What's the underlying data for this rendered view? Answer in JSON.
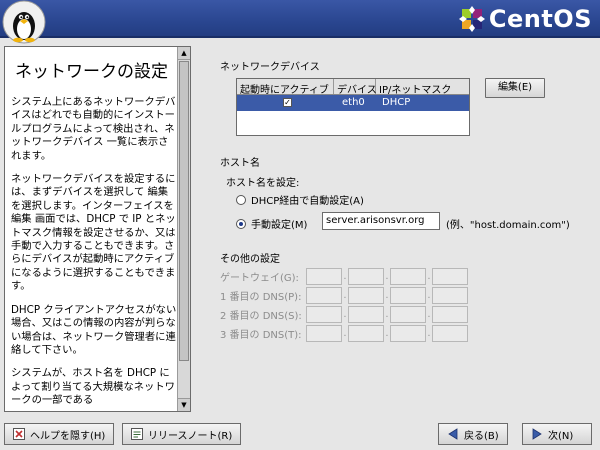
{
  "header": {
    "logo_text": "CentOS",
    "penguin_icon": "penguin-icon",
    "accent": "#2a4690"
  },
  "help": {
    "title": "ネットワークの設定",
    "paragraphs": [
      "システム上にあるネットワークデバイスはどれでも自動的にインストールプログラムによって検出され、ネットワークデバイス 一覧に表示されます。",
      "ネットワークデバイスを設定するには、まずデバイスを選択して 編集 を選択します。インターフェイスを編集 画面では、DHCP で IP とネットマスク情報を設定させるか、又は手動で入力することもできます。さらにデバイスが起動時にアクティブになるように選択することもできます。",
      "DHCP クライアントアクセスがない場合、又はこの情報の内容が判らない場合は、ネットワーク管理者に連絡して下さい。",
      "システムが、ホスト名を DHCP によって割り当てる大規模なネットワークの一部である"
    ]
  },
  "network_devices": {
    "section_title": "ネットワークデバイス",
    "columns": [
      "起動時にアクティブ",
      "デバイス",
      "IP/ネットマスク"
    ],
    "rows": [
      {
        "active": true,
        "device": "eth0",
        "ip": "DHCP"
      }
    ],
    "edit_button": "編集(E)"
  },
  "hostname": {
    "section_title": "ホスト名",
    "subtitle": "ホスト名を設定:",
    "option_dhcp": "DHCP経由で自動設定(A)",
    "option_manual": "手動設定(M)",
    "selected": "manual",
    "value": "server.arisonsvr.org",
    "example": "(例、\"host.domain.com\")"
  },
  "other": {
    "section_title": "その他の設定",
    "fields": [
      "ゲートウェイ(G):",
      "1 番目の DNS(P):",
      "2 番目の DNS(S):",
      "3 番目の DNS(T):"
    ]
  },
  "footer": {
    "hide_help": "ヘルプを隠す(H)",
    "release_notes": "リリースノート(R)",
    "back": "戻る(B)",
    "next": "次(N)"
  }
}
